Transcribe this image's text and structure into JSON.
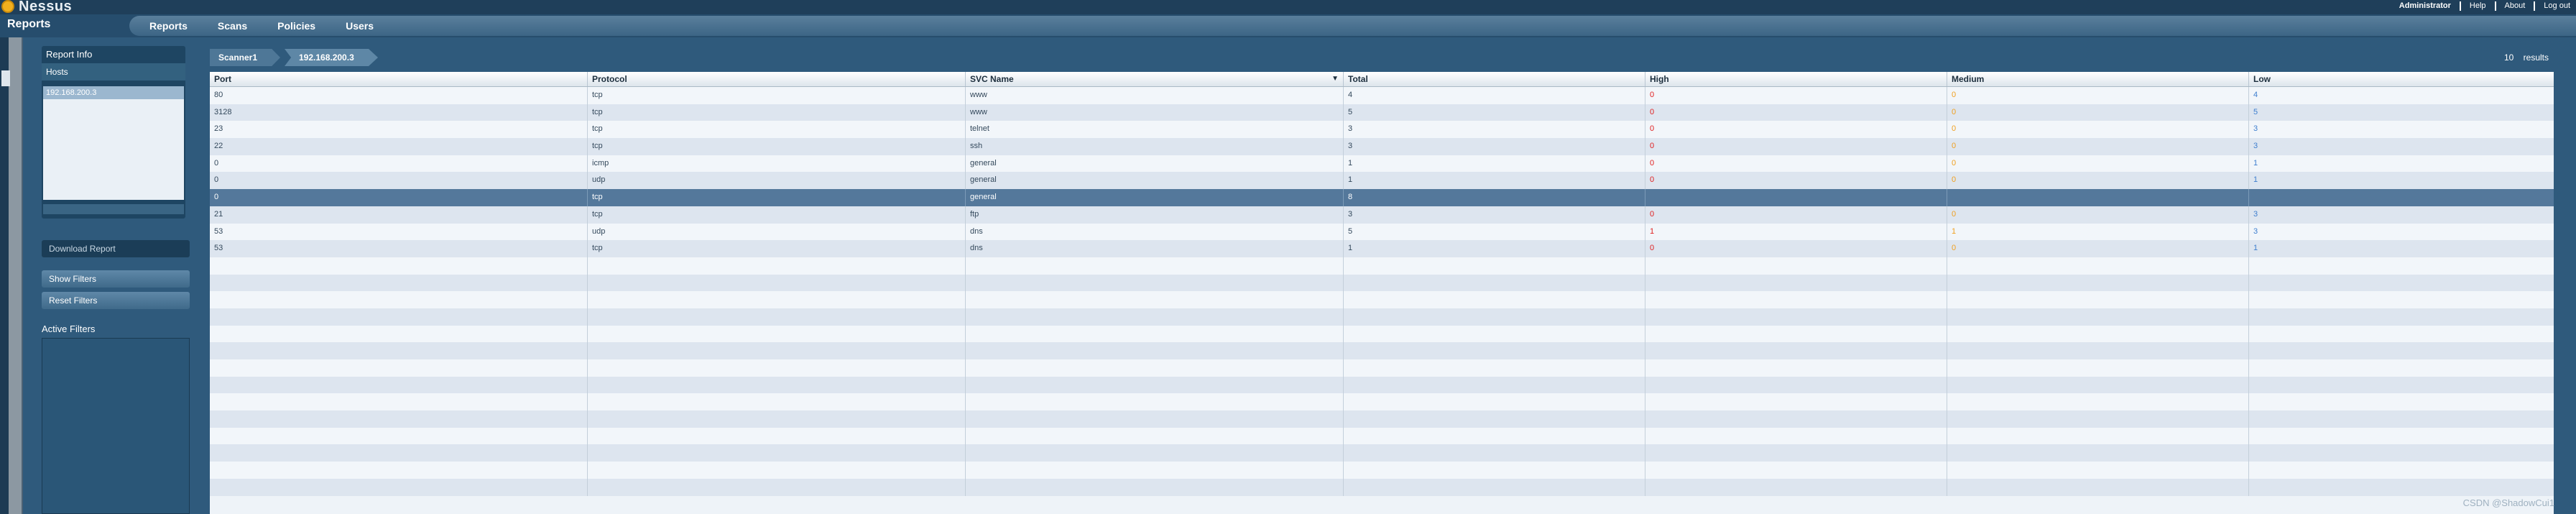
{
  "app": {
    "name": "Nessus",
    "page_title": "Reports",
    "user_links": [
      "Administrator",
      "Help",
      "About",
      "Log out"
    ]
  },
  "nav": {
    "tabs": [
      "Reports",
      "Scans",
      "Policies",
      "Users"
    ]
  },
  "sidebar": {
    "report_info": "Report Info",
    "hosts_label": "Hosts",
    "hosts": [
      "192.168.200.3"
    ],
    "download": "Download Report",
    "show_filters": "Show Filters",
    "reset_filters": "Reset Filters",
    "active_filters": "Active Filters"
  },
  "breadcrumb": [
    "Scanner1",
    "192.168.200.3"
  ],
  "results": {
    "count": "10",
    "label": "results"
  },
  "table": {
    "headers": [
      "Port",
      "Protocol",
      "SVC Name",
      "Total",
      "High",
      "Medium",
      "Low"
    ],
    "sorted_column": "SVC Name",
    "rows": [
      [
        "80",
        "tcp",
        "www",
        "4",
        "0",
        "0",
        "4"
      ],
      [
        "3128",
        "tcp",
        "www",
        "5",
        "0",
        "0",
        "5"
      ],
      [
        "23",
        "tcp",
        "telnet",
        "3",
        "0",
        "0",
        "3"
      ],
      [
        "22",
        "tcp",
        "ssh",
        "3",
        "0",
        "0",
        "3"
      ],
      [
        "0",
        "icmp",
        "general",
        "1",
        "0",
        "0",
        "1"
      ],
      [
        "0",
        "udp",
        "general",
        "1",
        "0",
        "0",
        "1"
      ],
      [
        "0",
        "tcp",
        "general",
        "8",
        "",
        "",
        ""
      ],
      [
        "21",
        "tcp",
        "ftp",
        "3",
        "0",
        "0",
        "3"
      ],
      [
        "53",
        "udp",
        "dns",
        "5",
        "1",
        "1",
        "3"
      ],
      [
        "53",
        "tcp",
        "dns",
        "1",
        "0",
        "0",
        "1"
      ]
    ],
    "selected_row": 6,
    "empty_rows": 14
  },
  "colors": {
    "high": "#e02020",
    "medium": "#f0a020",
    "low": "#3f7fcf",
    "selected": "#54789b"
  },
  "watermark": "CSDN @ShadowCui1"
}
